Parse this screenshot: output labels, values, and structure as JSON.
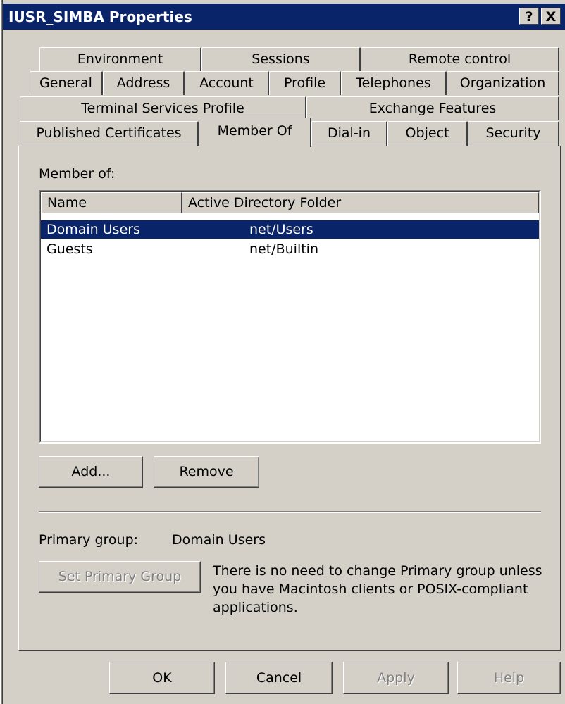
{
  "window": {
    "title": "IUSR_SIMBA Properties",
    "help_glyph": "?",
    "close_glyph": "X"
  },
  "tabs": {
    "row1": [
      "Environment",
      "Sessions",
      "Remote control"
    ],
    "row2": [
      "General",
      "Address",
      "Account",
      "Profile",
      "Telephones",
      "Organization"
    ],
    "row3": [
      "Terminal Services Profile",
      "Exchange Features"
    ],
    "row4": [
      "Published Certificates",
      "Member Of",
      "Dial-in",
      "Object",
      "Security"
    ],
    "active": "Member Of"
  },
  "member_of": {
    "label": "Member of:",
    "columns": [
      "Name",
      "Active Directory Folder"
    ],
    "rows": [
      {
        "name": "Domain Users",
        "folder": "net/Users",
        "selected": true
      },
      {
        "name": "Guests",
        "folder": "net/Builtin",
        "selected": false
      }
    ]
  },
  "buttons": {
    "add": "Add...",
    "remove": "Remove",
    "set_primary_group": "Set Primary Group",
    "ok": "OK",
    "cancel": "Cancel",
    "apply": "Apply",
    "help": "Help"
  },
  "primary_group": {
    "label": "Primary group:",
    "value": "Domain Users",
    "note": "There is no need to change Primary group unless you have Macintosh clients or POSIX-compliant applications."
  },
  "colors": {
    "titlebar": "#0a246a",
    "face": "#d4d0c8",
    "selection": "#0a246a"
  }
}
